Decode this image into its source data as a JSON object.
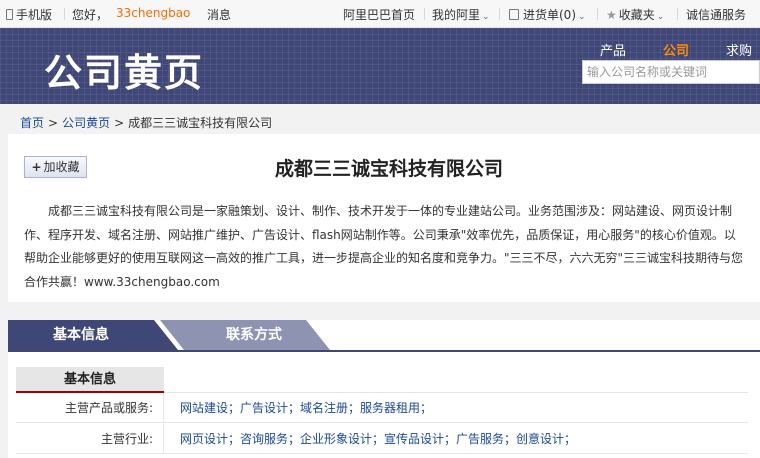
{
  "topbar": {
    "mobile": "手机版",
    "greeting": "您好，",
    "username": "33chengbao",
    "messages": "消息",
    "alibaba_home": "阿里巴巴首页",
    "my_alibaba": "我的阿里",
    "purchase_list": "进货单(0)",
    "favorites": "收藏夹",
    "trust_service": "诚信通服务"
  },
  "header": {
    "title": "公司黄页",
    "nav": [
      "产品",
      "公司",
      "求购"
    ],
    "search_placeholder": "输入公司名称或关键词"
  },
  "breadcrumb": {
    "home": "首页",
    "yellow_pages": "公司黄页",
    "current": "成都三三诚宝科技有限公司",
    "separator": ">"
  },
  "company": {
    "fav_button": "加收藏",
    "name": "成都三三诚宝科技有限公司",
    "intro": "成都三三诚宝科技有限公司是一家融策划、设计、制作、技术开发于一体的专业建站公司。业务范围涉及：网站建设、网页设计制作、程序开发、域名注册、网站推广维护、广告设计、flash网站制作等。公司秉承\"效率优先，品质保证，用心服务\"的核心价值观。以帮助企业能够更好的使用互联网这一高效的推广工具，进一步提高企业的知名度和竞争力。\"三三不尽，六六无穷\"三三诚宝科技期待与您合作共赢！www.33chengbao.com"
  },
  "tabs": {
    "basic": "基本信息",
    "contact": "联系方式"
  },
  "info": {
    "heading": "基本信息",
    "rows": [
      {
        "label": "主营产品或服务:",
        "value": "网站建设；广告设计；域名注册；服务器租用；"
      },
      {
        "label": "主营行业:",
        "value": "网页设计；咨询服务；企业形象设计；宣传品设计；广告服务；创意设计；"
      }
    ]
  },
  "colors": {
    "header_bg": "#3f4777",
    "accent_orange": "#ff6a00",
    "link_blue": "#1a4a9a",
    "heading_underline": "#a00000"
  }
}
